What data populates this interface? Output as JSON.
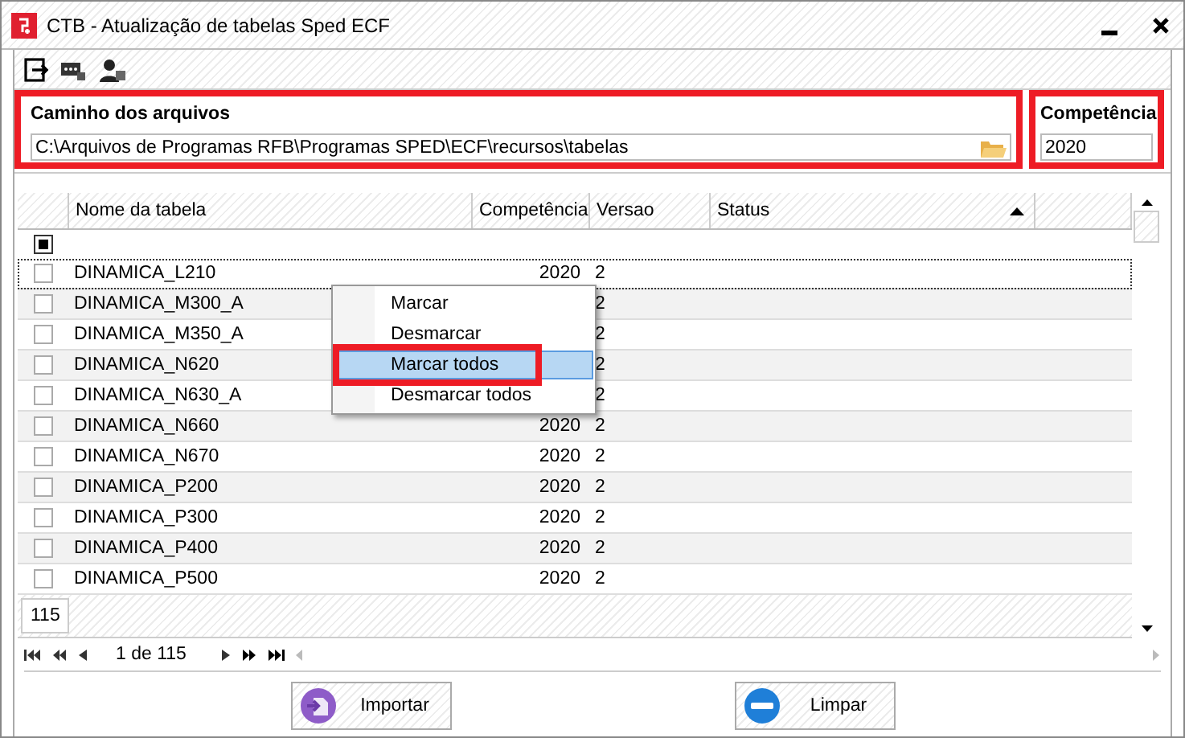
{
  "window": {
    "title": "CTB - Atualização de tabelas Sped ECF"
  },
  "path_panel": {
    "label": "Caminho dos arquivos",
    "value": "C:\\Arquivos de Programas RFB\\Programas SPED\\ECF\\recursos\\tabelas",
    "highlighted": true
  },
  "competencia_panel": {
    "label": "Competência",
    "value": "2020",
    "highlighted": true
  },
  "table": {
    "columns": [
      {
        "label": "Nome da tabela",
        "sorted": false
      },
      {
        "label": "Competência",
        "sorted": false
      },
      {
        "label": "Versao",
        "sorted": false
      },
      {
        "label": "Status",
        "sorted": true
      }
    ],
    "select_all": {
      "checked": true
    },
    "rows": [
      {
        "name": "DINAMICA_L210",
        "competencia": "2020",
        "versao": "2",
        "checked": false,
        "focused": true
      },
      {
        "name": "DINAMICA_M300_A",
        "versao": "2",
        "checked": false,
        "focused": false
      },
      {
        "name": "DINAMICA_M350_A",
        "versao": "2",
        "checked": false,
        "focused": false
      },
      {
        "name": "DINAMICA_N620",
        "versao": "2",
        "checked": false,
        "focused": false
      },
      {
        "name": "DINAMICA_N630_A",
        "versao": "2",
        "checked": false,
        "focused": false
      },
      {
        "name": "DINAMICA_N660",
        "competencia": "2020",
        "versao": "2",
        "checked": false,
        "focused": false
      },
      {
        "name": "DINAMICA_N670",
        "competencia": "2020",
        "versao": "2",
        "checked": false,
        "focused": false
      },
      {
        "name": "DINAMICA_P200",
        "competencia": "2020",
        "versao": "2",
        "checked": false,
        "focused": false
      },
      {
        "name": "DINAMICA_P300",
        "competencia": "2020",
        "versao": "2",
        "checked": false,
        "focused": false
      },
      {
        "name": "DINAMICA_P400",
        "competencia": "2020",
        "versao": "2",
        "checked": false,
        "focused": false
      },
      {
        "name": "DINAMICA_P500",
        "competencia": "2020",
        "versao": "2",
        "checked": false,
        "focused": false
      }
    ],
    "record_count": "115"
  },
  "pager": {
    "text": "1 de 115"
  },
  "context_menu": {
    "items": [
      {
        "label": "Marcar",
        "selected": false,
        "highlighted": false
      },
      {
        "label": "Desmarcar",
        "selected": false,
        "highlighted": false
      },
      {
        "label": "Marcar todos",
        "selected": true,
        "highlighted": true
      },
      {
        "label": "Desmarcar todos",
        "selected": false,
        "highlighted": false
      }
    ]
  },
  "buttons": [
    {
      "label": "Importar",
      "kind": "import"
    },
    {
      "label": "Limpar",
      "kind": "clear"
    }
  ]
}
